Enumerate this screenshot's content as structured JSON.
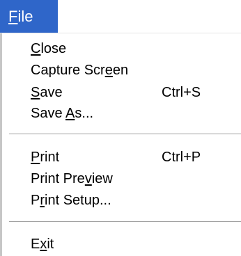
{
  "menubar": {
    "file": {
      "pre": "",
      "mnemonic": "F",
      "post": "ile"
    }
  },
  "menu": {
    "close": {
      "pre": "",
      "mnemonic": "C",
      "post": "lose",
      "shortcut": ""
    },
    "capture_screen": {
      "pre": "Capture Scr",
      "mnemonic": "e",
      "post": "en",
      "shortcut": ""
    },
    "save": {
      "pre": "",
      "mnemonic": "S",
      "post": "ave",
      "shortcut": "Ctrl+S"
    },
    "save_as": {
      "pre": "Save ",
      "mnemonic": "A",
      "post": "s...",
      "shortcut": ""
    },
    "print": {
      "pre": "",
      "mnemonic": "P",
      "post": "rint",
      "shortcut": "Ctrl+P"
    },
    "print_preview": {
      "pre": "Print Pre",
      "mnemonic": "v",
      "post": "iew",
      "shortcut": ""
    },
    "print_setup": {
      "pre": "P",
      "mnemonic": "r",
      "post": "int Setup...",
      "shortcut": ""
    },
    "exit": {
      "pre": "E",
      "mnemonic": "x",
      "post": "it",
      "shortcut": ""
    }
  },
  "colors": {
    "menubar_highlight": "#2f66c9",
    "menu_background": "#ffffff",
    "separator": "#a0a0a0"
  }
}
